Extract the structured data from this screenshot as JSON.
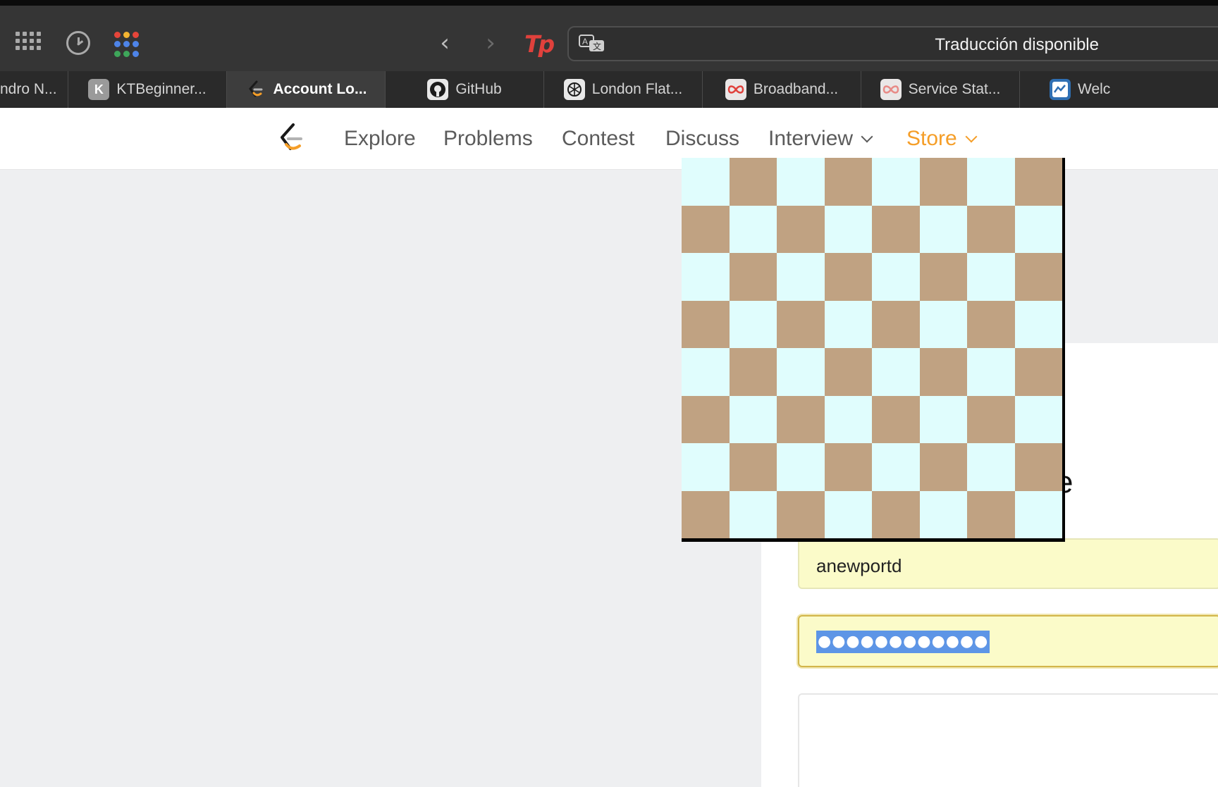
{
  "browser": {
    "address_bar": {
      "text": "Traducción disponible"
    },
    "tp_label": "Tp",
    "tabs": [
      {
        "label": "ndro N...",
        "active": false
      },
      {
        "label": "KTBeginner...",
        "favicon_letter": "K",
        "active": false
      },
      {
        "label": "Account Lo...",
        "active": true
      },
      {
        "label": "GitHub",
        "active": false
      },
      {
        "label": "London Flat...",
        "active": false
      },
      {
        "label": "Broadband...",
        "active": false
      },
      {
        "label": "Service Stat...",
        "active": false
      },
      {
        "label": "Welc",
        "active": false
      }
    ],
    "icons": [
      "apps-grid-icon",
      "history-icon",
      "colored-dots-icon",
      "back-arrow-icon",
      "forward-arrow-icon",
      "translate-icon"
    ]
  },
  "site_nav": {
    "links": [
      "Explore",
      "Problems",
      "Contest",
      "Discuss",
      "Interview",
      "Store"
    ],
    "accent_color": "#f59e28"
  },
  "login": {
    "username_value": "anewportd",
    "password_mask": "●●●●●●●●●●●●",
    "partial_heading_glyph": "e"
  },
  "chessboard": {
    "rows": 8,
    "cols": 8,
    "light_color": "#e0fdfd",
    "dark_color": "#c0a282"
  }
}
